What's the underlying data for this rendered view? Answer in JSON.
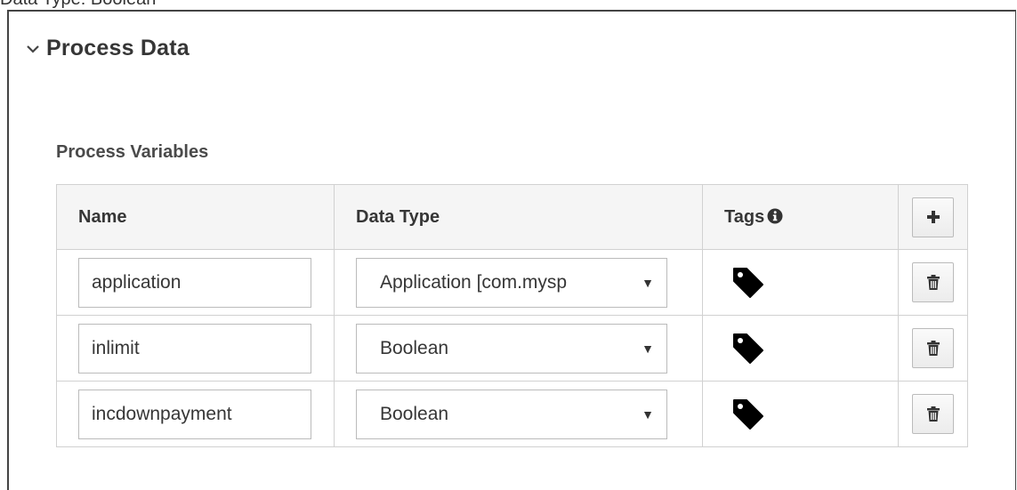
{
  "top_fragment": "Data Type: Boolean",
  "section": {
    "title": "Process Data",
    "expanded": true
  },
  "process_variables": {
    "label": "Process Variables",
    "columns": {
      "name": "Name",
      "data_type": "Data Type",
      "tags": "Tags"
    },
    "rows": [
      {
        "name": "application",
        "data_type": "Application [com.mysp"
      },
      {
        "name": "inlimit",
        "data_type": "Boolean"
      },
      {
        "name": "incdownpayment",
        "data_type": "Boolean"
      }
    ]
  },
  "icons": {
    "section_toggle": "chevron-down-icon",
    "tags_info": "info-icon",
    "add": "plus-icon",
    "tag": "tag-icon",
    "delete": "trash-icon"
  }
}
